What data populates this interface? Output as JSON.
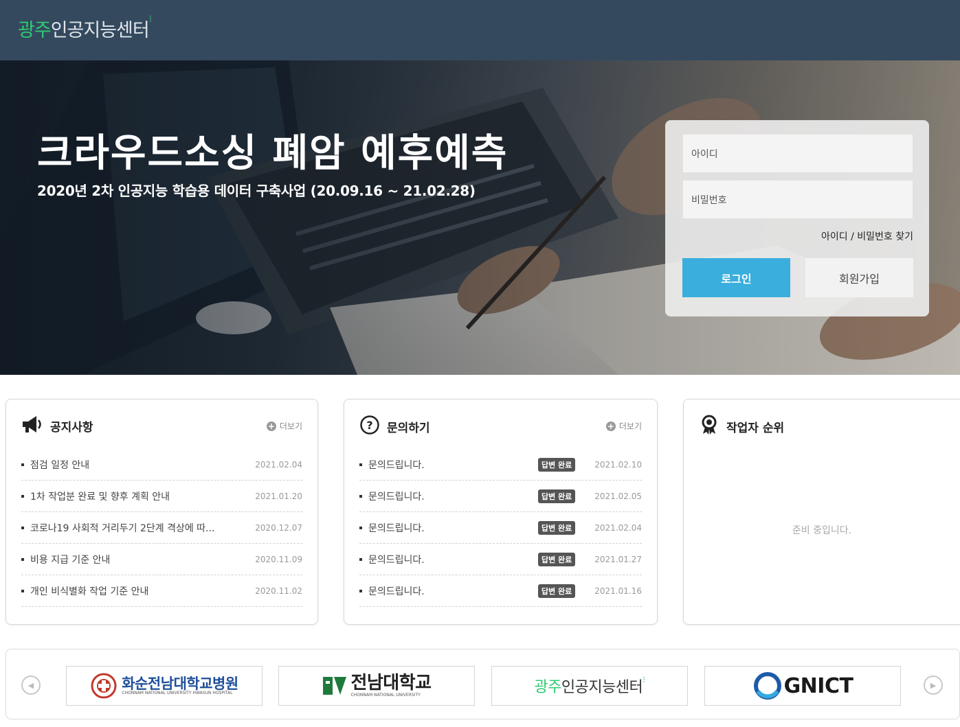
{
  "header": {
    "logo_accent": "광주",
    "logo_rest": "인공지능센터",
    "logo_mark": "⁝"
  },
  "hero": {
    "title": "크라우드소싱 폐암 예후예측",
    "subtitle": "2020년 2차 인공지능 학습용 데이터 구축사업 (20.09.16 ~ 21.02.28)"
  },
  "login": {
    "id_placeholder": "아이디",
    "pw_placeholder": "비밀번호",
    "find_link": "아이디 / 비밀번호 찾기",
    "login_button": "로그인",
    "join_button": "회원가입"
  },
  "notice": {
    "title": "공지사항",
    "more": "더보기",
    "items": [
      {
        "title": "점검 일정 안내",
        "date": "2021.02.04"
      },
      {
        "title": "1차 작업분 완료 및 향후 계획 안내",
        "date": "2021.01.20"
      },
      {
        "title": "코로나19 사회적 거리두기 2단계 격상에 따...",
        "date": "2020.12.07"
      },
      {
        "title": "비용 지급 기준 안내",
        "date": "2020.11.09"
      },
      {
        "title": "개인 비식별화 작업 기준 안내",
        "date": "2020.11.02"
      }
    ]
  },
  "inquiry": {
    "title": "문의하기",
    "more": "더보기",
    "items": [
      {
        "title": "문의드립니다.",
        "badge": "답변 완료",
        "date": "2021.02.10"
      },
      {
        "title": "문의드립니다.",
        "badge": "답변 완료",
        "date": "2021.02.05"
      },
      {
        "title": "문의드립니다.",
        "badge": "답변 완료",
        "date": "2021.02.04"
      },
      {
        "title": "문의드립니다.",
        "badge": "답변 완료",
        "date": "2021.01.27"
      },
      {
        "title": "문의드립니다.",
        "badge": "답변 완료",
        "date": "2021.01.16"
      }
    ]
  },
  "ranking": {
    "title": "작업자 순위",
    "empty": "준비 중입니다."
  },
  "partners": {
    "items": [
      {
        "name": "화순전남대학교병원",
        "sub": "CHONNAM NATIONAL UNIVERSITY HWASUN HOSPITAL"
      },
      {
        "name": "전남대학교",
        "sub": "CHONNAM NATIONAL UNIVERSITY"
      },
      {
        "name_accent": "광주",
        "name": "인공지능센터"
      },
      {
        "name": "GNICT"
      }
    ]
  },
  "colors": {
    "header_bg": "#34495e",
    "accent_green": "#2ecc71",
    "login_button": "#3aaedd"
  }
}
